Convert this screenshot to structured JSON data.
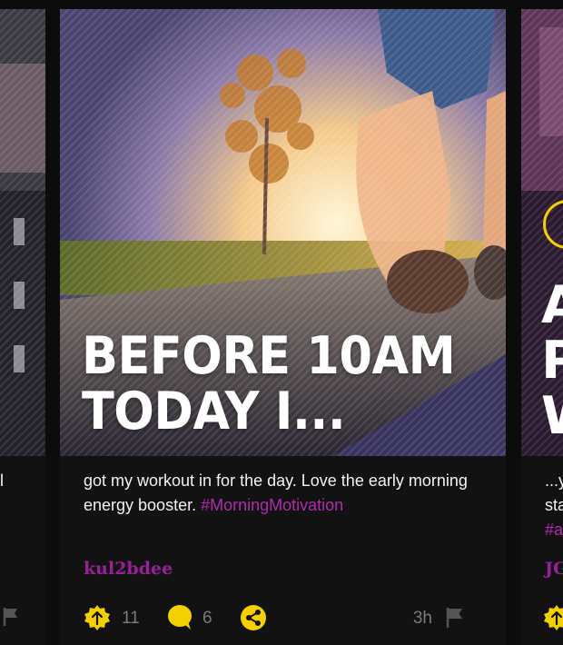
{
  "left_card": {
    "caption_fragment": "l"
  },
  "main_card": {
    "headline_lines": [
      "BEFORE 10AM",
      "TODAY I..."
    ],
    "caption": "got my workout in for the day.  Love the early morning energy booster.",
    "hashtag": "#MorningMotivation",
    "username": "kul2bdee",
    "upvote_count": "11",
    "comment_count": "6",
    "time_ago": "3h",
    "icons": {
      "upvote": "upvote-icon",
      "comment": "comment-icon",
      "share": "share-icon",
      "flag": "flag-icon"
    }
  },
  "right_card": {
    "headline_lines": [
      "A",
      "P",
      "W"
    ],
    "caption_lines": [
      "...y",
      "sta"
    ],
    "hashtag_fragment": "#a",
    "username_fragment": "JG"
  },
  "colors": {
    "accent_yellow": "#f5d000",
    "hashtag_purple": "#b02bb0",
    "username_purple": "#9a1f9a",
    "meta_gray": "#7a7a7a"
  }
}
